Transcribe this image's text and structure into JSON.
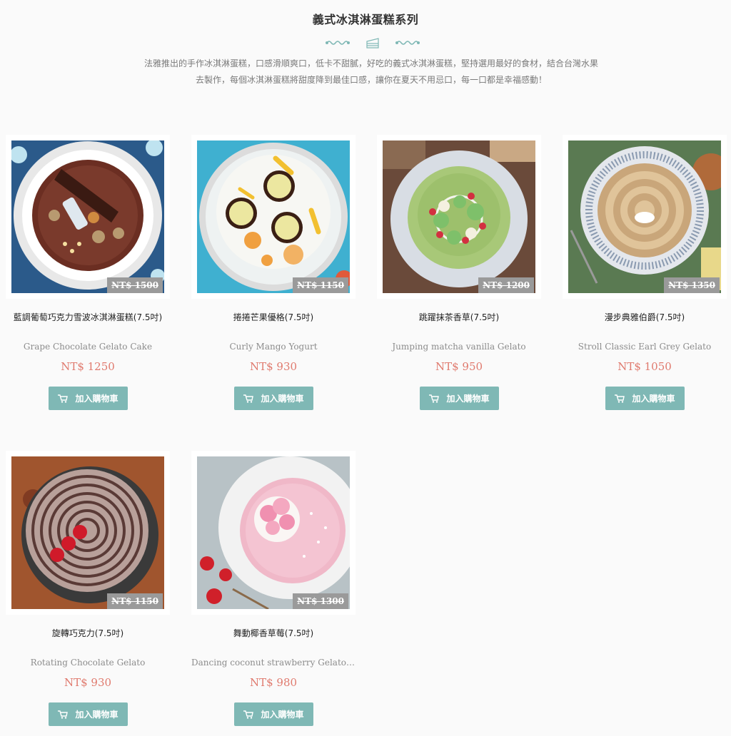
{
  "page": {
    "title": "義式冰淇淋蛋糕系列",
    "intro": "法雅推出的手作冰淇淋蛋糕，口感滑順爽口，低卡不甜膩，好吃的義式冰淇淋蛋糕，堅持選用最好的食材，結合台灣水果去製作，每個冰淇淋蛋糕將甜度降到最佳口感，讓你在夏天不用忌口，每一口都是幸福感動！",
    "divider_icon": "cake-icon",
    "accent_color": "#7fb8b5",
    "price_color": "#e07a6e"
  },
  "products": [
    {
      "name": "藍調葡萄巧克力雪波冰淇淋蛋糕(7.5吋)",
      "name_en": "Grape Chocolate Gelato Cake",
      "original_price": "NT$ 1500",
      "price": "NT$ 1250",
      "button": "加入購物車",
      "image_desc": "chocolate-cake-icon"
    },
    {
      "name": "捲捲芒果優格(7.5吋)",
      "name_en": "Curly Mango Yogurt",
      "original_price": "NT$ 1150",
      "price": "NT$ 930",
      "button": "加入購物車",
      "image_desc": "mango-cake-icon"
    },
    {
      "name": "跳躍抹茶香草(7.5吋)",
      "name_en": "Jumping matcha vanilla Gelato",
      "original_price": "NT$ 1200",
      "price": "NT$ 950",
      "button": "加入購物車",
      "image_desc": "matcha-cake-icon"
    },
    {
      "name": "漫步典雅伯爵(7.5吋)",
      "name_en": "Stroll Classic Earl Grey Gelato",
      "original_price": "NT$ 1350",
      "price": "NT$ 1050",
      "button": "加入購物車",
      "image_desc": "earl-grey-cake-icon"
    },
    {
      "name": "旋轉巧克力(7.5吋)",
      "name_en": "Rotating Chocolate Gelato",
      "original_price": "NT$ 1150",
      "price": "NT$ 930",
      "button": "加入購物車",
      "image_desc": "swirl-chocolate-cake-icon"
    },
    {
      "name": "舞動椰香草莓(7.5吋)",
      "name_en": "Dancing coconut strawberry Gelato ...",
      "original_price": "NT$ 1300",
      "price": "NT$ 980",
      "button": "加入購物車",
      "image_desc": "strawberry-cake-icon"
    }
  ]
}
